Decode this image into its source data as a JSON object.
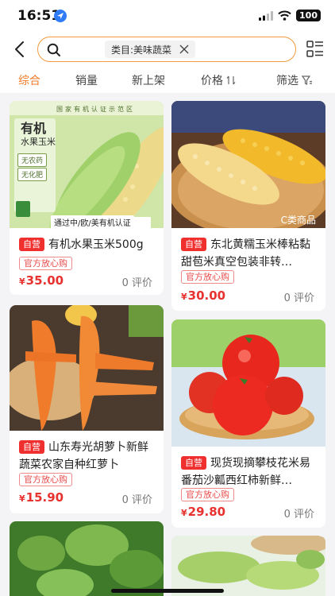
{
  "status": {
    "time": "16:51",
    "battery": "100"
  },
  "search": {
    "tag": "类目:美味蔬菜"
  },
  "sort": {
    "items": [
      "综合",
      "销量",
      "新上架",
      "价格",
      "筛选"
    ]
  },
  "badges": {
    "self": "自营",
    "official": "官方放心购"
  },
  "products": [
    {
      "title": "有机水果玉米500g",
      "price": "35.00",
      "currency": "¥",
      "reviews": "0 评价",
      "image_text": {
        "heading": "有机",
        "sub": "水果玉米",
        "chips": [
          "无农药",
          "无化肥"
        ],
        "cert": "通过中/欧/美有机认证",
        "banner": "国家有机认证示范区"
      }
    },
    {
      "title": "东北黄糯玉米棒粘黏甜苞米真空包装非转…",
      "price": "30.00",
      "currency": "¥",
      "reviews": "0 评价",
      "image_text": {
        "watermark": "C类商品"
      }
    },
    {
      "title": "山东寿光胡萝卜新鲜蔬菜农家自种红萝卜",
      "price": "15.90",
      "currency": "¥",
      "reviews": "0 评价"
    },
    {
      "title": "现货现摘攀枝花米易番茄沙瓤西红柿新鲜…",
      "price": "29.80",
      "currency": "¥",
      "reviews": "0 评价"
    }
  ],
  "colors": {
    "accent": "#f07a26",
    "price": "#e8322f",
    "badge": "#f02f2f"
  }
}
